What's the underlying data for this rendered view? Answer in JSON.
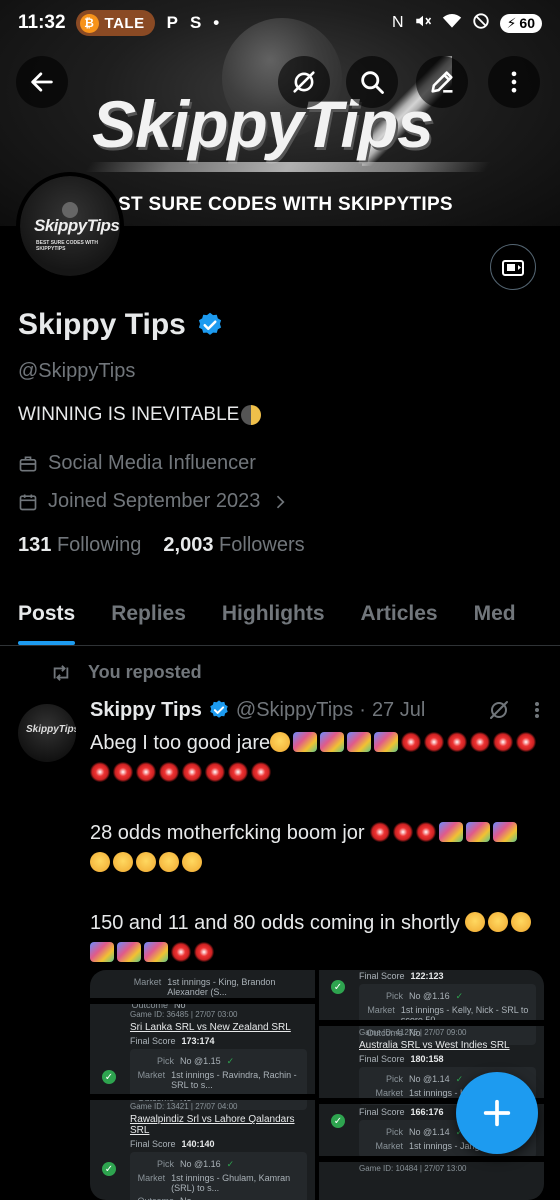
{
  "status_bar": {
    "time": "11:32",
    "tale_label": "TALE",
    "app_icons": [
      "P",
      "S",
      "•"
    ],
    "battery": "60"
  },
  "banner": {
    "title": "SkippyTips",
    "subtitle": "ST SURE CODES WITH SKIPPYTIPS"
  },
  "avatar": {
    "title": "SkippyTips",
    "subtitle": "BEST SURE CODES WITH SKIPPYTIPS"
  },
  "profile": {
    "display_name": "Skippy Tips",
    "handle": "@SkippyTips",
    "bio": "WINNING IS INEVITABLE",
    "category": "Social Media Influencer",
    "joined": "Joined September 2023",
    "following_count": "131",
    "following_label": "Following",
    "followers_count": "2,003",
    "followers_label": "Followers"
  },
  "tabs": [
    {
      "label": "Posts",
      "active": true
    },
    {
      "label": "Replies",
      "active": false
    },
    {
      "label": "Highlights",
      "active": false
    },
    {
      "label": "Articles",
      "active": false
    },
    {
      "label": "Med",
      "active": false
    }
  ],
  "post": {
    "repost_label": "You reposted",
    "name": "Skippy Tips",
    "handle": "@SkippyTips",
    "separator": "·",
    "date": "27 Jul",
    "line1": "Abeg I too good jare",
    "line2": "28 odds motherfcking boom jor",
    "line3": "150 and 11 and 80 odds coming in shortly"
  },
  "media": {
    "left": [
      {
        "id": "",
        "title": "",
        "pick": "",
        "market": "1st innings - King, Brandon Alexander (S...",
        "outcome": "No",
        "final": ""
      },
      {
        "id": "Game ID: 36485 | 27/07 03:00",
        "title": "Sri Lanka SRL vs New Zealand SRL",
        "final": "173:174",
        "pick": "No @1.15",
        "market": "1st innings - Ravindra, Rachin - SRL to s...",
        "outcome": "No"
      },
      {
        "id": "Game ID: 13421 | 27/07 04:00",
        "title": "Rawalpindiz Srl vs Lahore Qalandars SRL",
        "final": "140:140",
        "pick": "No @1.16",
        "market": "1st innings - Ghulam, Kamran (SRL) to s...",
        "outcome": "No"
      }
    ],
    "right": [
      {
        "id": "",
        "title": "",
        "final": "122:123",
        "pick": "No @1.16",
        "market": "1st innings - Kelly, Nick - SRL to score 50",
        "outcome": "No"
      },
      {
        "id": "Game ID: 41276 | 27/07 09:00",
        "title": "Australia SRL vs West Indies SRL",
        "final": "180:158",
        "pick": "No @1.14",
        "market": "1st innings - King, B...",
        "outcome": ""
      },
      {
        "id": "",
        "title": "",
        "final": "166:176",
        "pick": "No @1.14",
        "market": "1st innings - Jang...",
        "outcome": ""
      },
      {
        "id": "Game ID: 10484 | 27/07 13:00",
        "title": "",
        "final": "",
        "pick": "",
        "market": "",
        "outcome": ""
      }
    ],
    "labels": {
      "pick": "Pick",
      "market": "Market",
      "outcome": "Outcome",
      "final": "Final Score"
    }
  },
  "colors": {
    "accent": "#1d9bf0",
    "muted": "#71767b",
    "text": "#e7e9ea",
    "tale": "#8a4a24"
  }
}
